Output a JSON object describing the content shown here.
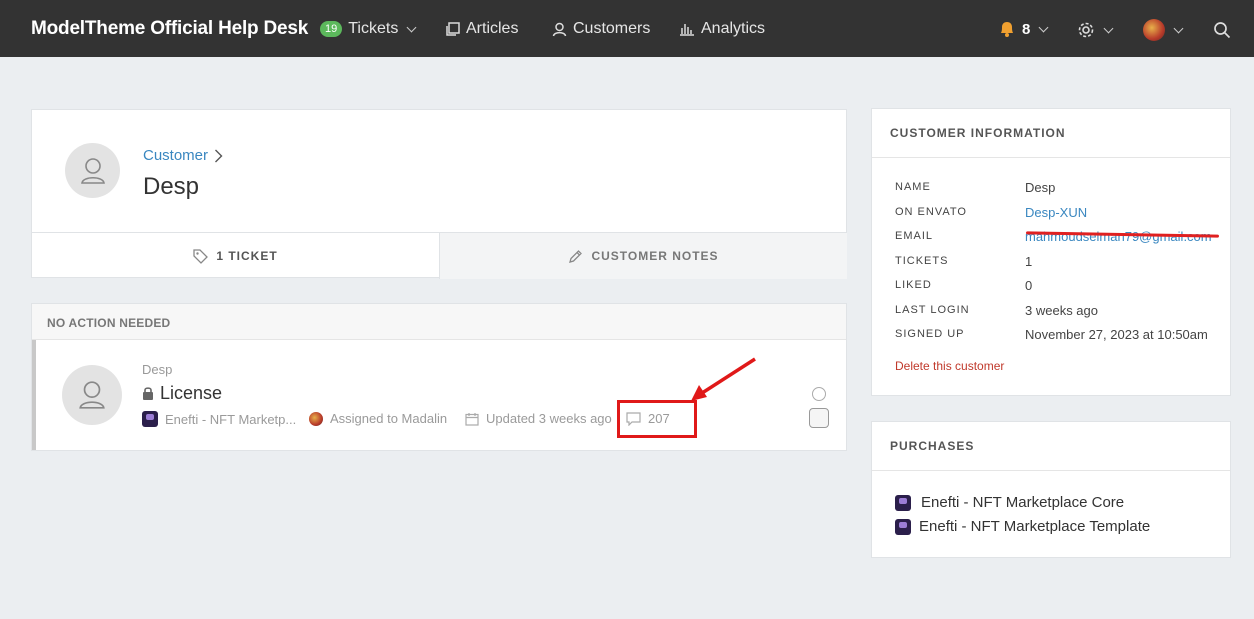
{
  "header": {
    "brand": "ModelTheme Official Help Desk",
    "nav": [
      {
        "label": "Tickets",
        "badge": "19",
        "icon": "ticket-icon",
        "has_dropdown": true
      },
      {
        "label": "Articles",
        "icon": "articles-icon"
      },
      {
        "label": "Customers",
        "icon": "customers-icon"
      },
      {
        "label": "Analytics",
        "icon": "analytics-icon"
      }
    ],
    "notifications_count": "8",
    "accent": "#5cb85c"
  },
  "customer": {
    "breadcrumb": "Customer",
    "name": "Desp",
    "tabs": [
      {
        "label": "1 TICKET",
        "icon": "tag-icon",
        "active": true
      },
      {
        "label": "CUSTOMER NOTES",
        "icon": "pencil-icon",
        "active": false
      }
    ]
  },
  "tickets": {
    "section_label": "NO ACTION NEEDED",
    "items": [
      {
        "author": "Desp",
        "title": "License",
        "product": "Enefti - NFT Marketp...",
        "assigned": "Assigned to Madalin",
        "updated": "Updated 3 weeks ago",
        "replies": "207"
      }
    ]
  },
  "info": {
    "title": "CUSTOMER INFORMATION",
    "rows": [
      {
        "label": "NAME",
        "value": "Desp"
      },
      {
        "label": "ON ENVATO",
        "value": "Desp-XUN"
      },
      {
        "label": "EMAIL",
        "value": "mahmoudselman79@gmail.com"
      },
      {
        "label": "TICKETS",
        "value": "1"
      },
      {
        "label": "LIKED",
        "value": "0"
      },
      {
        "label": "LAST LOGIN",
        "value": "3 weeks ago"
      },
      {
        "label": "SIGNED UP",
        "value": "November 27, 2023 at 10:50am"
      }
    ],
    "delete_label": "Delete this customer"
  },
  "purchases": {
    "title": "PURCHASES",
    "items": [
      "Enefti - NFT Marketplace Core",
      "Enefti - NFT Marketplace Template"
    ]
  }
}
